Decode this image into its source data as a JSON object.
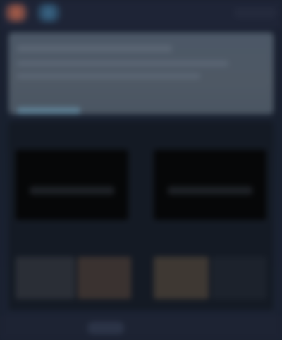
{
  "app": {
    "title": "",
    "note": ""
  },
  "topbar": {
    "icons": [
      "app-icon-a",
      "app-icon-b"
    ],
    "right_label": ""
  },
  "banner": {
    "title": "",
    "subtitle": ""
  },
  "tiles": [
    {
      "label": ""
    },
    {
      "label": ""
    }
  ],
  "bottombar": {
    "active_label": ""
  },
  "colors": {
    "background": "#1a2130",
    "banner": "#4b5766",
    "accent": "#5e7f93",
    "tile": "#060708"
  }
}
